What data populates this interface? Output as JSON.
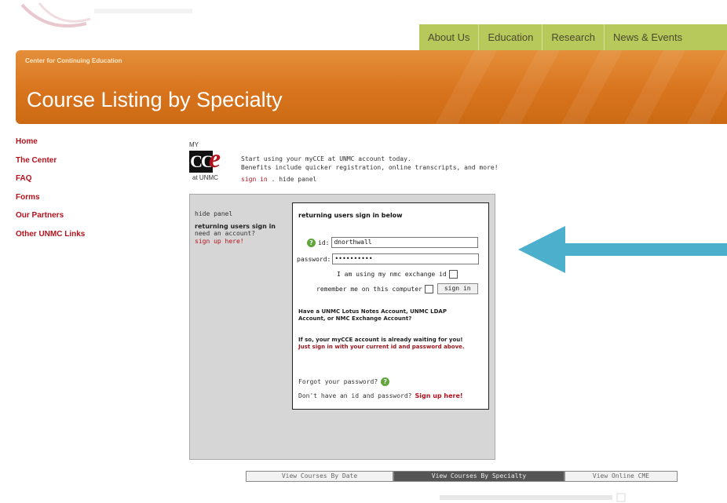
{
  "top_nav": {
    "items": [
      "About Us",
      "Education",
      "Research",
      "News & Events"
    ]
  },
  "banner": {
    "subtitle": "Center for Continuing Education",
    "title": "Course Listing by Specialty"
  },
  "left_nav": {
    "items": [
      "Home",
      "The Center",
      "FAQ",
      "Forms",
      "Our Partners",
      "Other UNMC Links"
    ]
  },
  "mycce": {
    "my": "MY",
    "cc": "CC",
    "e": "e",
    "at": "at UNMC",
    "promo_line1": "Start using your myCCE at UNMC account today.",
    "promo_line2": "Benefits include quicker registration, online transcripts, and more!",
    "sign_in": "sign in",
    "separator": ".",
    "hide_panel": "hide panel"
  },
  "panel": {
    "side_hide": "hide panel",
    "side_returning": "returning users sign in",
    "side_need": "need an account?",
    "side_signup": "sign up here!",
    "heading": "returning users sign in below",
    "id_label": "id:",
    "id_value": "dnorthwall",
    "password_label": "password:",
    "password_value": "••••••••••",
    "exchange_label": "I am using my nmc exchange id",
    "remember_label": "remember me on this computer",
    "sign_in_button": "sign in",
    "info1_line1": "Have a UNMC Lotus Notes Account, UNMC LDAP",
    "info1_line2": "Account, or NMC Exchange Account?",
    "info2_line1": "If so, your myCCE account is already waiting for you!",
    "info2_line2": "Just sign in with your current id and password above.",
    "forgot": "Forgot your password?",
    "no_account": "Don't have an id and password?",
    "signup_here": "Sign up here!"
  },
  "bottom_tabs": {
    "items": [
      "View Courses By Date",
      "View Courses By Specialty",
      "View Online CME"
    ]
  },
  "colors": {
    "accent_orange": "#d9741e",
    "nav_green": "#b7c95a",
    "link_red": "#b3121d",
    "arrow_blue": "#4cb0cc"
  }
}
